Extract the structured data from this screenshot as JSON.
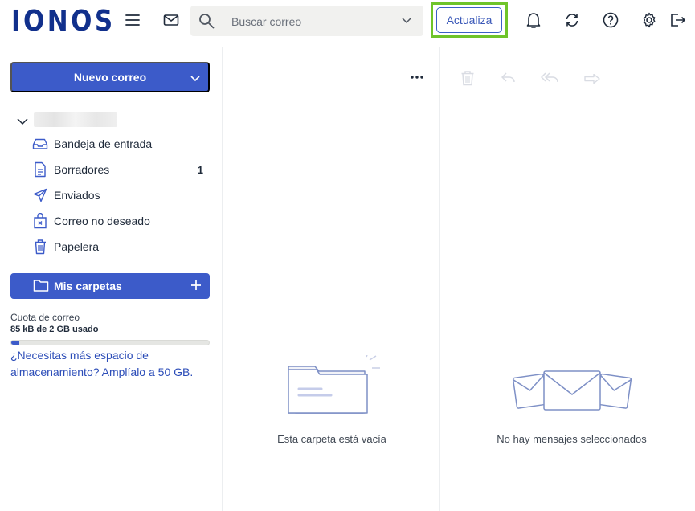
{
  "header": {
    "logo": "IONOS",
    "search_placeholder": "Buscar correo",
    "upgrade_label": "Actualiza",
    "icons": [
      "menu-icon",
      "mail-icon",
      "bell-icon",
      "sync-icon",
      "help-icon",
      "gear-icon",
      "logout-icon"
    ]
  },
  "sidebar": {
    "compose_label": "Nuevo correo",
    "folders": [
      {
        "label": "Bandeja de entrada",
        "icon": "inbox-icon",
        "count": ""
      },
      {
        "label": "Borradores",
        "icon": "draft-icon",
        "count": "1"
      },
      {
        "label": "Enviados",
        "icon": "sent-icon",
        "count": ""
      },
      {
        "label": "Correo no deseado",
        "icon": "spam-icon",
        "count": ""
      },
      {
        "label": "Papelera",
        "icon": "trash-icon",
        "count": ""
      }
    ],
    "my_folders_label": "Mis carpetas",
    "quota": {
      "label": "Cuota de correo",
      "used": "85 kB de 2 GB usado",
      "fraction": 0.04,
      "link": "¿Necesitas más espacio de almacenamiento? Amplíalo a 50 GB."
    }
  },
  "list": {
    "empty_text": "Esta carpeta está vacía"
  },
  "reader": {
    "empty_text": "No hay mensajes seleccionados",
    "tools": [
      "trash-icon",
      "reply-icon",
      "reply-all-icon",
      "forward-icon"
    ]
  },
  "colors": {
    "brand": "#11308c",
    "accent": "#3c5bc9",
    "highlight": "#6fc42a"
  }
}
